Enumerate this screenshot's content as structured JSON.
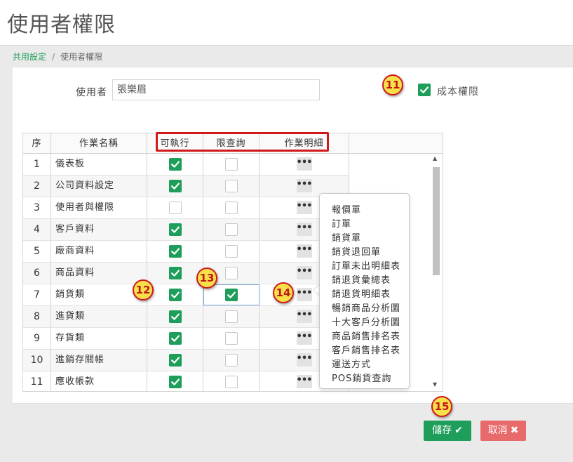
{
  "page": {
    "title": "使用者權限"
  },
  "breadcrumb": {
    "parent": "共用設定",
    "separator": "/",
    "current": "使用者權限"
  },
  "user": {
    "label": "使用者",
    "value": "張樂眉"
  },
  "cost_permission": {
    "label": "成本權限",
    "checked": true
  },
  "table": {
    "headers": {
      "no": "序",
      "name": "作業名稱",
      "execute": "可執行",
      "query": "限查詢",
      "detail": "作業明細"
    },
    "rows": [
      {
        "no": "1",
        "name": "儀表板",
        "execute": true,
        "query": false
      },
      {
        "no": "2",
        "name": "公司資料設定",
        "execute": true,
        "query": false
      },
      {
        "no": "3",
        "name": "使用者與權限",
        "execute": false,
        "query": false
      },
      {
        "no": "4",
        "name": "客戶資料",
        "execute": true,
        "query": false
      },
      {
        "no": "5",
        "name": "廠商資料",
        "execute": true,
        "query": false
      },
      {
        "no": "6",
        "name": "商品資料",
        "execute": true,
        "query": false
      },
      {
        "no": "7",
        "name": "銷貨類",
        "execute": true,
        "query": true
      },
      {
        "no": "8",
        "name": "進貨類",
        "execute": true,
        "query": false
      },
      {
        "no": "9",
        "name": "存貨類",
        "execute": true,
        "query": false
      },
      {
        "no": "10",
        "name": "進銷存關帳",
        "execute": true,
        "query": false
      },
      {
        "no": "11",
        "name": "應收帳款",
        "execute": true,
        "query": false
      }
    ],
    "detail_button": "•••"
  },
  "popover": {
    "items": [
      "報價單",
      "訂單",
      "銷貨單",
      "銷貨退回單",
      "訂單未出明細表",
      "銷退貨彙總表",
      "銷退貨明細表",
      "暢銷商品分析圖",
      "十大客戶分析圖",
      "商品銷售排名表",
      "客戶銷售排名表",
      "運送方式",
      "POS銷貨查詢"
    ]
  },
  "badges": [
    "11",
    "12",
    "13",
    "14",
    "15"
  ],
  "buttons": {
    "save": "儲存",
    "cancel": "取消"
  },
  "colors": {
    "accent": "#1e9e5a",
    "danger": "#e86a6a",
    "badge": "#f7e04a",
    "highlight": "#d01919"
  },
  "icons": {
    "save": "check-icon",
    "cancel": "x-icon"
  }
}
